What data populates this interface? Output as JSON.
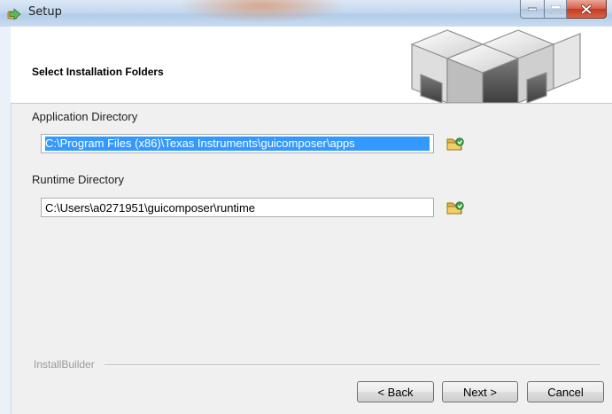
{
  "window": {
    "title": "Setup",
    "caption_buttons": [
      "minimize",
      "maximize",
      "close"
    ],
    "icon": "installer-app-icon"
  },
  "header": {
    "title": "Select Installation Folders",
    "logo_icon": "cube-logo-icon"
  },
  "fields": {
    "application_directory": {
      "label": "Application Directory",
      "value": "C:\\Program Files (x86)\\Texas Instruments\\guicomposer\\apps",
      "selected": true,
      "browse_icon": "folder-browse-icon"
    },
    "runtime_directory": {
      "label": "Runtime Directory",
      "value": "C:\\Users\\a0271951\\guicomposer\\runtime",
      "browse_icon": "folder-browse-icon"
    }
  },
  "footer": {
    "brand": "InstallBuilder",
    "back_label": "< Back",
    "next_label": "Next >",
    "cancel_label": "Cancel"
  },
  "colors": {
    "selection": "#3399ff",
    "close_button": "#c23a22",
    "titlebar": "#c4d8ee"
  }
}
